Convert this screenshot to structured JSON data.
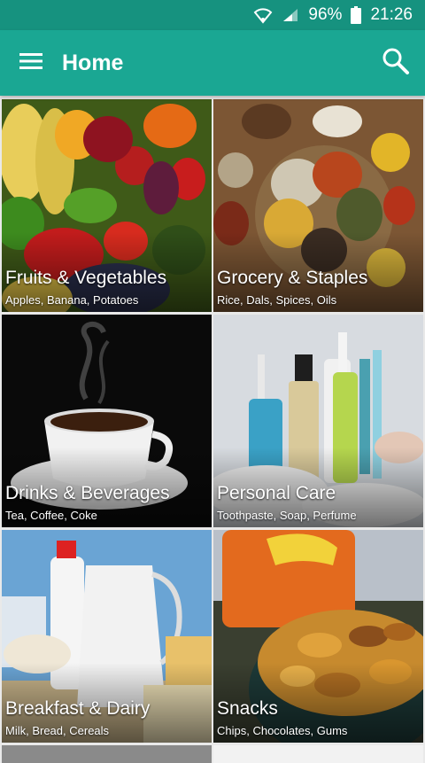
{
  "status": {
    "battery": "96%",
    "time": "21:26"
  },
  "appbar": {
    "title": "Home"
  },
  "icons": {
    "menu": "menu-icon",
    "search": "search-icon",
    "wifi": "wifi-icon",
    "signal": "signal-icon",
    "battery": "battery-icon"
  },
  "colors": {
    "status_bar": "#16927f",
    "app_bar": "#1aa793",
    "background": "#e9e9e9"
  },
  "categories": [
    {
      "name": "Fruits & Vegetables",
      "subtitle": "Apples, Banana, Potatoes"
    },
    {
      "name": "Grocery & Staples",
      "subtitle": "Rice, Dals, Spices, Oils"
    },
    {
      "name": "Drinks & Beverages",
      "subtitle": "Tea, Coffee, Coke"
    },
    {
      "name": "Personal Care",
      "subtitle": "Toothpaste, Soap, Perfume"
    },
    {
      "name": "Breakfast & Dairy",
      "subtitle": "Milk, Bread, Cereals"
    },
    {
      "name": "Snacks",
      "subtitle": "Chips, Chocolates, Gums"
    }
  ]
}
